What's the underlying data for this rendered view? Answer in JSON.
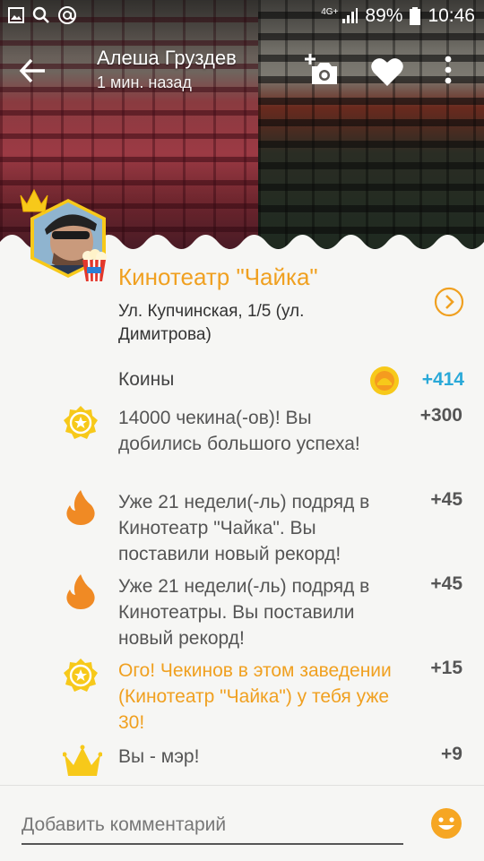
{
  "status_bar": {
    "network": "4G+",
    "battery": "89%",
    "time": "10:46"
  },
  "header": {
    "user_name": "Алеша Груздев",
    "time_ago": "1 мин. назад"
  },
  "venue": {
    "name": "Кинотеатр \"Чайка\"",
    "address": "Ул. Купчинская, 1/5 (ул. Димитрова)"
  },
  "coins": {
    "label": "Коины",
    "total": "+414"
  },
  "items": [
    {
      "icon": "star-badge-icon",
      "text": "14000 чекина(-ов)! Вы добились большого успеха!",
      "points": "+300",
      "highlight": false
    },
    {
      "icon": "flame-icon",
      "text": "Уже 21 недели(-ль) подряд в Кинотеатр \"Чайка\". Вы поставили новый рекорд!",
      "points": "+45",
      "highlight": false
    },
    {
      "icon": "flame-icon",
      "text": "Уже 21 недели(-ль) подряд в Кинотеатры. Вы поставили новый рекорд!",
      "points": "+45",
      "highlight": false
    },
    {
      "icon": "star-badge-icon",
      "text": "Ого! Чекинов в этом заведении (Кинотеатр \"Чайка\") у тебя уже 30!",
      "points": "+15",
      "highlight": true
    },
    {
      "icon": "crown-icon",
      "text": "Вы - мэр!",
      "points": "+9",
      "highlight": false
    }
  ],
  "comment": {
    "placeholder": "Добавить комментарий"
  },
  "colors": {
    "accent": "#f0a020",
    "coins_blue": "#2aa9d8",
    "badge_yellow": "#f7c91a",
    "flame_orange": "#f08a24"
  }
}
